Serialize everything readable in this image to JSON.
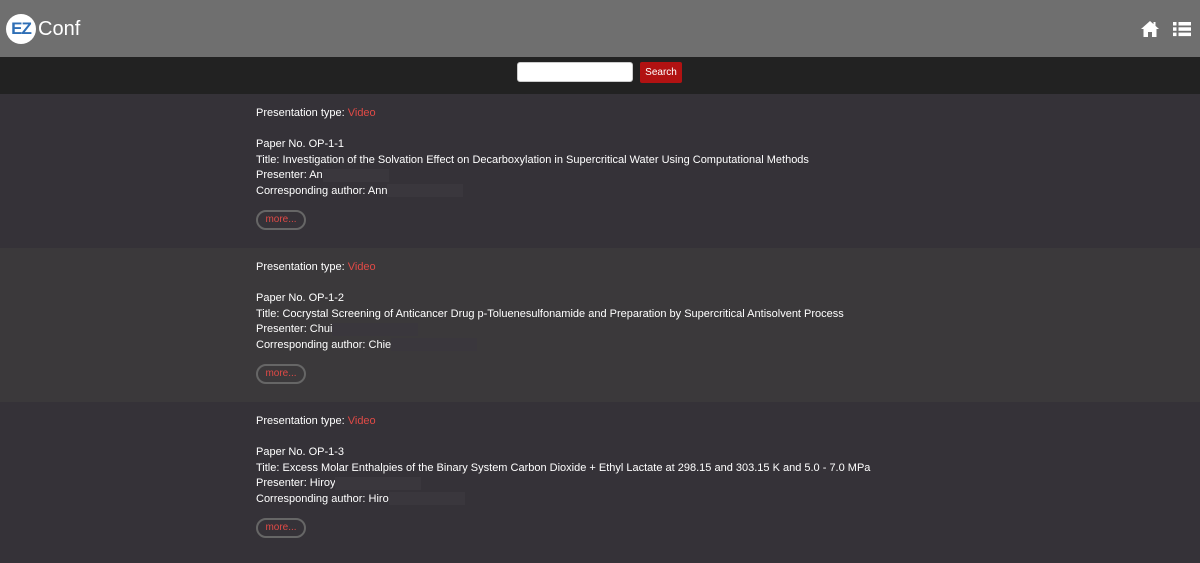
{
  "header": {
    "logo_ez": "EZ",
    "logo_conf": "Conf",
    "icons": [
      "home-icon",
      "list-menu-icon"
    ]
  },
  "search": {
    "value": "",
    "button_label": "Search"
  },
  "colors": {
    "accent": "#e04a46",
    "search_button": "#b11212"
  },
  "entries": [
    {
      "type_label": "Presentation type:",
      "type_value": "Video",
      "paper_no": "Paper No. OP-1-1",
      "title": "Title: Investigation of the Solvation Effect on Decarboxylation in Supercritical Water Using Computational Methods",
      "presenter": "Presenter: An",
      "corresponding": "Corresponding author: Ann",
      "more": "more..."
    },
    {
      "type_label": "Presentation type:",
      "type_value": "Video",
      "paper_no": "Paper No. OP-1-2",
      "title": "Title: Cocrystal Screening of Anticancer Drug p-Toluenesulfonamide and Preparation by Supercritical Antisolvent Process",
      "presenter": "Presenter: Chui",
      "corresponding": "Corresponding author: Chie",
      "more": "more..."
    },
    {
      "type_label": "Presentation type:",
      "type_value": "Video",
      "paper_no": "Paper No. OP-1-3",
      "title": "Title: Excess Molar Enthalpies of the Binary System Carbon Dioxide + Ethyl Lactate at 298.15 and 303.15 K and 5.0 - 7.0 MPa",
      "presenter": "Presenter: Hiroy",
      "corresponding": "Corresponding author: Hiro",
      "more": "more..."
    }
  ]
}
